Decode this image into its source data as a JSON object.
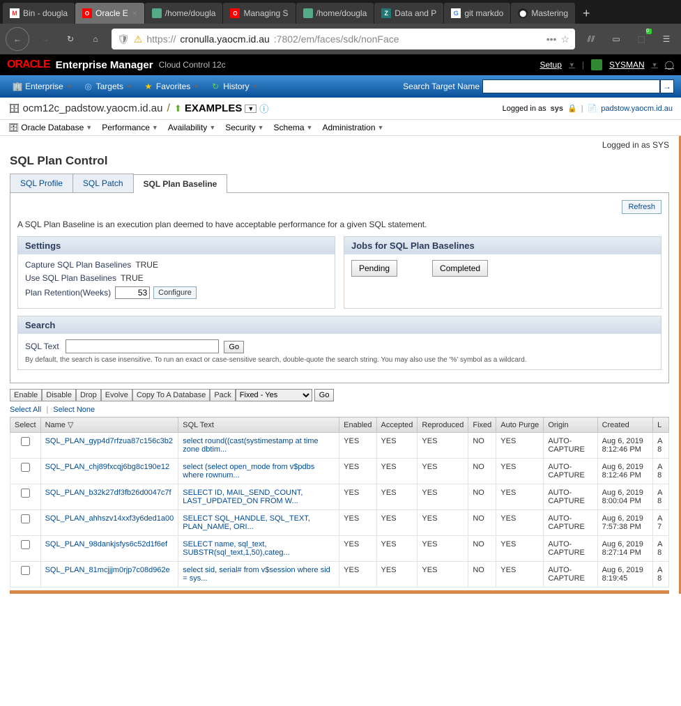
{
  "browser": {
    "tabs": [
      {
        "label": "Bin - dougla"
      },
      {
        "label": "Oracle E"
      },
      {
        "label": "/home/dougla"
      },
      {
        "label": "Managing S"
      },
      {
        "label": "/home/dougla"
      },
      {
        "label": "Data and P"
      },
      {
        "label": "git markdo"
      },
      {
        "label": "Mastering"
      }
    ],
    "url": {
      "scheme": "https://",
      "host": "cronulla.yaocm.id.au",
      "path": ":7802/em/faces/sdk/nonFace"
    }
  },
  "oracle": {
    "logo": "ORACLE",
    "title": "Enterprise Manager",
    "subtitle": "Cloud Control 12c",
    "setup": "Setup",
    "user": "SYSMAN"
  },
  "menubar": {
    "items": [
      "Enterprise",
      "Targets",
      "Favorites",
      "History"
    ],
    "search_label": "Search Target Name"
  },
  "context": {
    "title": "ocm12c_padstow.yaocm.id.au",
    "examples": "EXAMPLES",
    "logged_in_text": "Logged in as",
    "user": "sys",
    "db_link": "padstow.yaocm.id.au"
  },
  "submenu": [
    "Oracle Database",
    "Performance",
    "Availability",
    "Security",
    "Schema",
    "Administration"
  ],
  "page": {
    "logged_as": "Logged in as SYS",
    "title": "SQL Plan Control",
    "tabs": [
      "SQL Profile",
      "SQL Patch",
      "SQL Plan Baseline"
    ],
    "refresh": "Refresh",
    "desc": "A SQL Plan Baseline is an execution plan deemed to have acceptable performance for a given SQL statement."
  },
  "settings": {
    "header": "Settings",
    "capture_label": "Capture SQL Plan Baselines",
    "capture_val": "TRUE",
    "use_label": "Use SQL Plan Baselines",
    "use_val": "TRUE",
    "retention_label": "Plan Retention(Weeks)",
    "retention_val": "53",
    "configure": "Configure"
  },
  "jobs": {
    "header": "Jobs for SQL Plan Baselines",
    "pending": "Pending",
    "completed": "Completed"
  },
  "search": {
    "header": "Search",
    "label": "SQL Text",
    "go": "Go",
    "hint": "By default, the search is case insensitive. To run an exact or case-sensitive search, double-quote the search string. You may also use the '%' symbol as a wildcard."
  },
  "actions": {
    "enable": "Enable",
    "disable": "Disable",
    "drop": "Drop",
    "evolve": "Evolve",
    "copy": "Copy To A Database",
    "pack": "Pack",
    "fixed": "Fixed - Yes",
    "go": "Go",
    "select_all": "Select All",
    "select_none": "Select None"
  },
  "table": {
    "headers": [
      "Select",
      "Name",
      "SQL Text",
      "Enabled",
      "Accepted",
      "Reproduced",
      "Fixed",
      "Auto Purge",
      "Origin",
      "Created",
      "L"
    ],
    "rows": [
      {
        "name": "SQL_PLAN_gyp4d7rfzua87c156c3b2",
        "sql": "select round((cast(systimestamp at time zone dbtim...",
        "enabled": "YES",
        "accepted": "YES",
        "reproduced": "YES",
        "fixed": "NO",
        "auto": "YES",
        "origin": "AUTO-CAPTURE",
        "created": "Aug 6, 2019 8:12:46 PM",
        "l": "A 8"
      },
      {
        "name": "SQL_PLAN_chj89fxcqj6bg8c190e12",
        "sql": "select (select open_mode from v$pdbs where rownum...",
        "enabled": "YES",
        "accepted": "YES",
        "reproduced": "YES",
        "fixed": "NO",
        "auto": "YES",
        "origin": "AUTO-CAPTURE",
        "created": "Aug 6, 2019 8:12:46 PM",
        "l": "A 8"
      },
      {
        "name": "SQL_PLAN_b32k27df3fb26d0047c7f",
        "sql": "SELECT ID, MAIL_SEND_COUNT, LAST_UPDATED_ON FROM W...",
        "enabled": "YES",
        "accepted": "YES",
        "reproduced": "YES",
        "fixed": "NO",
        "auto": "YES",
        "origin": "AUTO-CAPTURE",
        "created": "Aug 6, 2019 8:00:04 PM",
        "l": "A 8"
      },
      {
        "name": "SQL_PLAN_ahhszv14xxf3y6ded1a00",
        "sql": "SELECT SQL_HANDLE, SQL_TEXT, PLAN_NAME, ORI...",
        "enabled": "YES",
        "accepted": "YES",
        "reproduced": "YES",
        "fixed": "NO",
        "auto": "YES",
        "origin": "AUTO-CAPTURE",
        "created": "Aug 6, 2019 7:57:38 PM",
        "l": "A 7"
      },
      {
        "name": "SQL_PLAN_98dankjsfys6c52d1f6ef",
        "sql": "SELECT name, sql_text, SUBSTR(sql_text,1,50),categ...",
        "enabled": "YES",
        "accepted": "YES",
        "reproduced": "YES",
        "fixed": "NO",
        "auto": "YES",
        "origin": "AUTO-CAPTURE",
        "created": "Aug 6, 2019 8:27:14 PM",
        "l": "A 8"
      },
      {
        "name": "SQL_PLAN_81mcjjjm0rjp7c08d962e",
        "sql": "select sid, serial# from v$session where sid = sys...",
        "enabled": "YES",
        "accepted": "YES",
        "reproduced": "YES",
        "fixed": "NO",
        "auto": "YES",
        "origin": "AUTO-CAPTURE",
        "created": "Aug 6, 2019 8:19:45",
        "l": "A 8"
      }
    ]
  }
}
